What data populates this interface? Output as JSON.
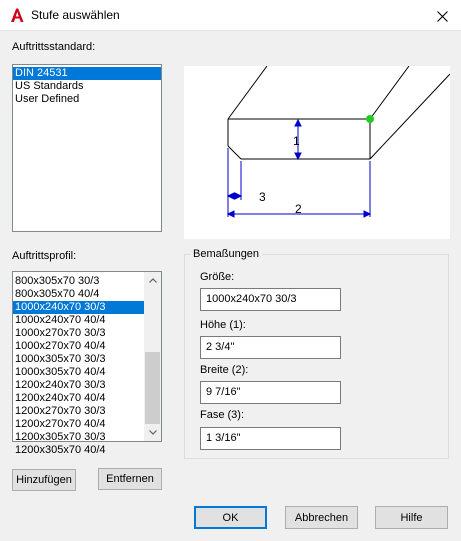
{
  "window": {
    "title": "Stufe auswählen",
    "close_icon": "close-icon",
    "app_icon": "autocad-icon",
    "accent_color": "#0078d7"
  },
  "standard": {
    "label": "Auftrittsstandard:",
    "items": [
      "DIN 24531",
      "US Standards",
      "User Defined"
    ],
    "selected": "DIN 24531"
  },
  "profile": {
    "label": "Auftrittsprofil:",
    "items": [
      "800x305x70 30/3",
      "800x305x70 40/4",
      "1000x240x70 30/3",
      "1000x240x70 40/4",
      "1000x270x70 30/3",
      "1000x270x70 40/4",
      "1000x305x70 30/3",
      "1000x305x70 40/4",
      "1200x240x70 30/3",
      "1200x240x70 40/4",
      "1200x270x70 30/3",
      "1200x270x70 40/4",
      "1200x305x70 30/3",
      "1200x305x70 40/4"
    ],
    "selected": "1000x240x70 30/3",
    "add_label": "Hinzufügen",
    "remove_label": "Entfernen"
  },
  "preview": {
    "dim_labels": [
      "1",
      "2",
      "3"
    ]
  },
  "dimensions": {
    "group_title": "Bemaßungen",
    "size_label": "Größe:",
    "size_value": "1000x240x70 30/3",
    "height_label": "Höhe (1):",
    "height_value": "2 3/4\"",
    "width_label": "Breite (2):",
    "width_value": "9 7/16\"",
    "chamfer_label": "Fase (3):",
    "chamfer_value": "1 3/16\""
  },
  "footer": {
    "ok_label": "OK",
    "cancel_label": "Abbrechen",
    "help_label": "Hilfe"
  }
}
